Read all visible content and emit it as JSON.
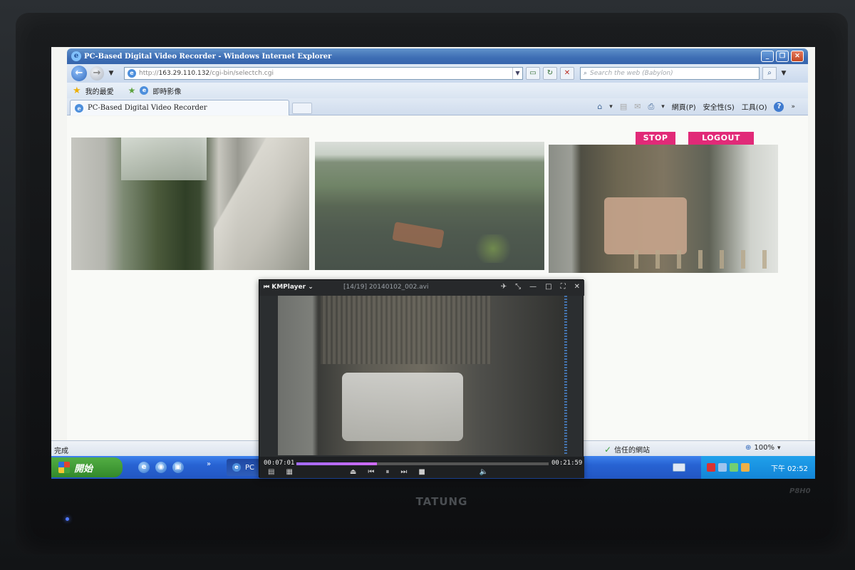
{
  "browser": {
    "window_title": "PC-Based Digital Video Recorder - Windows Internet Explorer",
    "address_prefix": "http://",
    "address_host": "163.29.110.132",
    "address_path": "/cgi-bin/selectch.cgi",
    "search_placeholder": "Search the web (Babylon)",
    "favorites_label": "我的最愛",
    "favorite_link": "即時影像",
    "tab_title": "PC-Based Digital Video Recorder",
    "menu_page": "網頁(P)",
    "menu_safety": "安全性(S)",
    "menu_tools": "工具(O)",
    "status_text": "完成",
    "trusted_zone": "信任的網站",
    "zoom_level": "100%"
  },
  "page": {
    "stop_label": "STOP",
    "logout_label": "LOGOUT"
  },
  "taskbar": {
    "start_label": "開始",
    "task_label": "PC",
    "clock": "下午 02:52"
  },
  "kmplayer": {
    "app_name": "KMPlayer",
    "file_label": "[14/19] 20140102_002.avi",
    "elapsed": "00:07:01",
    "total": "00:21:59",
    "progress_fraction": 0.32
  },
  "monitor": {
    "brand": "TATUNG",
    "model": "P8H0"
  },
  "icons": {
    "ie": "ie-logo-icon",
    "back": "back-arrow-icon",
    "forward": "forward-arrow-icon",
    "refresh": "refresh-icon",
    "stop_load": "stop-load-icon",
    "search": "search-icon",
    "favorites": "star-icon",
    "home": "home-icon",
    "feeds": "feed-icon",
    "mail": "mail-icon",
    "print": "print-icon",
    "help": "help-icon"
  }
}
